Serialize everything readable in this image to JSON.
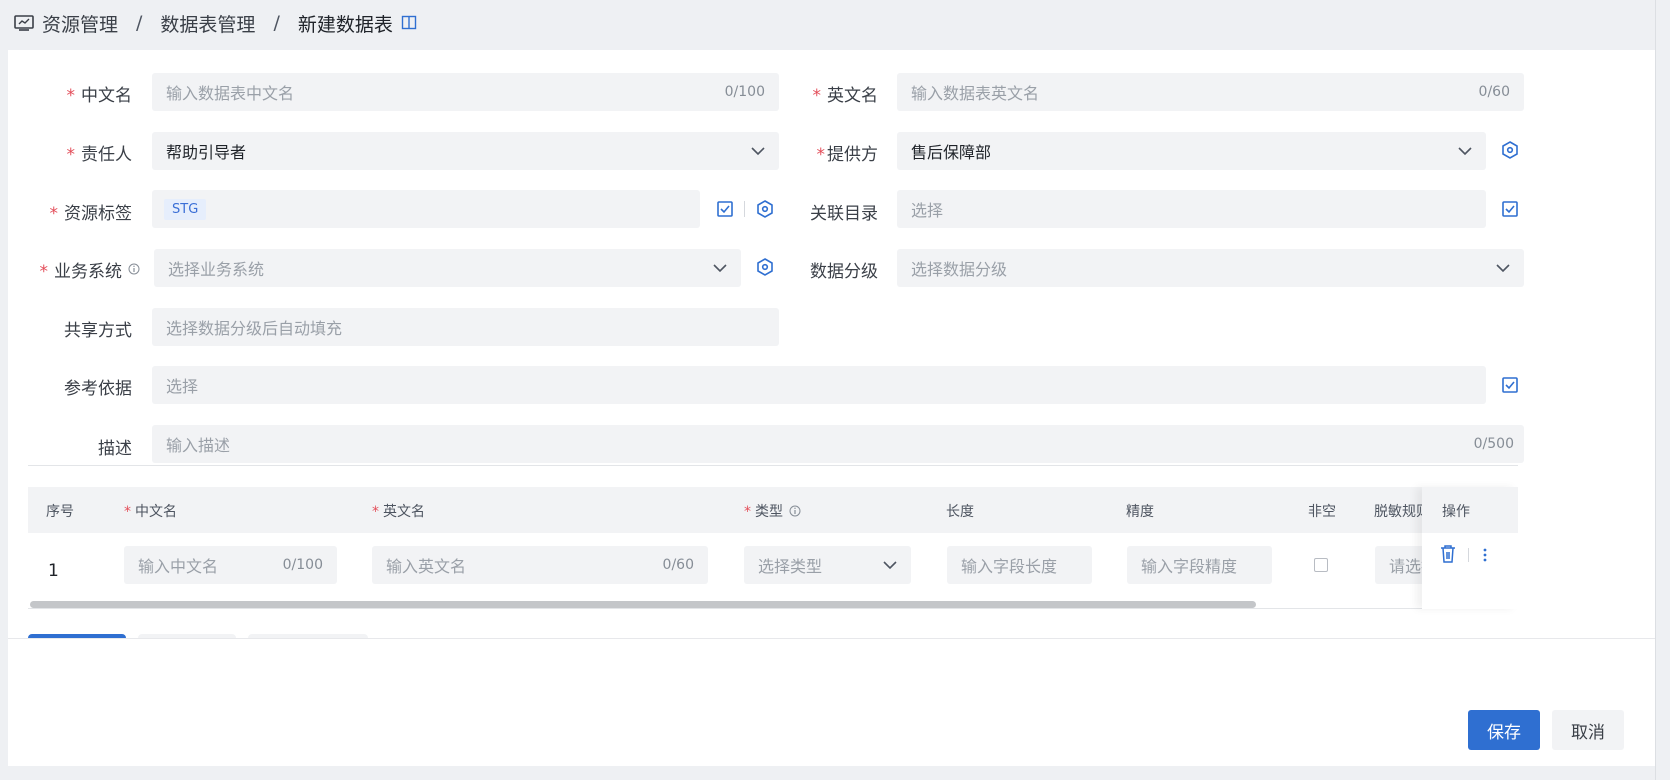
{
  "breadcrumb": {
    "item1": "资源管理",
    "sep": "/",
    "item2": "数据表管理",
    "item3": "新建数据表"
  },
  "form": {
    "cn_name": {
      "label": "中文名",
      "placeholder": "输入数据表中文名",
      "count": "0/100"
    },
    "en_name": {
      "label": "英文名",
      "placeholder": "输入数据表英文名",
      "count": "0/60"
    },
    "owner": {
      "label": "责任人",
      "value": "帮助引导者"
    },
    "provider": {
      "label": "提供方",
      "value": "售后保障部"
    },
    "tags": {
      "label": "资源标签",
      "tag": "STG"
    },
    "catalog": {
      "label": "关联目录",
      "placeholder": "选择"
    },
    "biz_system": {
      "label": "业务系统",
      "placeholder": "选择业务系统"
    },
    "data_level": {
      "label": "数据分级",
      "placeholder": "选择数据分级"
    },
    "share": {
      "label": "共享方式",
      "placeholder": "选择数据分级后自动填充"
    },
    "reference": {
      "label": "参考依据",
      "placeholder": "选择"
    },
    "desc": {
      "label": "描述",
      "placeholder": "输入描述",
      "count": "0/500"
    }
  },
  "table": {
    "headers": {
      "index": "序号",
      "cn_name": "中文名",
      "en_name": "英文名",
      "type": "类型",
      "length": "长度",
      "precision": "精度",
      "not_null": "非空",
      "mask": "脱敏规则",
      "ops": "操作"
    },
    "row": {
      "index": "1",
      "cn_placeholder": "输入中文名",
      "cn_count": "0/100",
      "en_placeholder": "输入英文名",
      "en_count": "0/60",
      "type_placeholder": "选择类型",
      "length_placeholder": "输入字段长度",
      "precision_placeholder": "输入字段精度",
      "mask_placeholder": "请选择"
    }
  },
  "actions": {
    "save": "保存",
    "cancel": "取消"
  },
  "colors": {
    "accent": "#2f6fd1",
    "required": "#e34d59",
    "field_bg": "#f2f3f5"
  }
}
